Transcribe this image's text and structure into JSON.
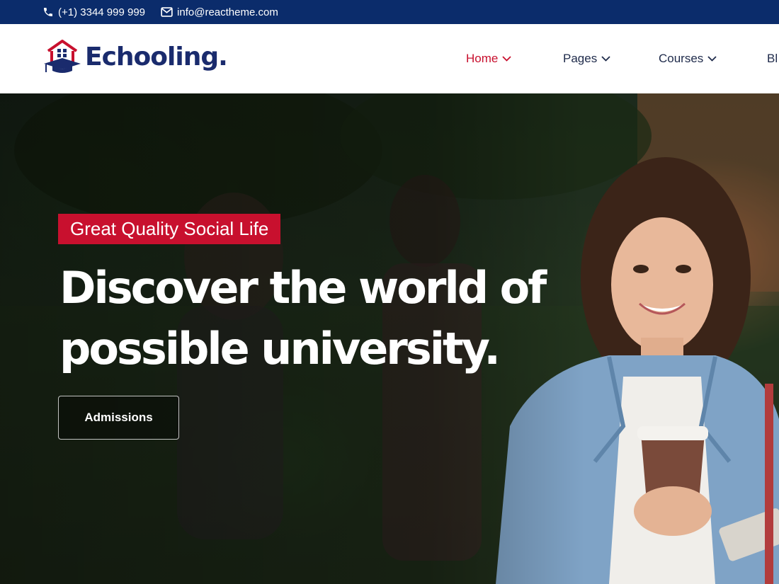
{
  "topbar": {
    "phone": "(+1) 3344 999 999",
    "email": "info@reactheme.com",
    "phone_icon": "phone-icon",
    "email_icon": "envelope-icon"
  },
  "header": {
    "logo_text": "Echooling.",
    "logo_icon": "house-graduation-cap-icon",
    "nav": [
      {
        "label": "Home",
        "active": true,
        "icon": "chevron-down-icon"
      },
      {
        "label": "Pages",
        "active": false,
        "icon": "chevron-down-icon"
      },
      {
        "label": "Courses",
        "active": false,
        "icon": "chevron-down-icon"
      },
      {
        "label": "Bl",
        "active": false
      }
    ]
  },
  "hero": {
    "tagline": "Great Quality Social Life",
    "headline_line1": "Discover the world of",
    "headline_line2": "possible university.",
    "cta_label": "Admissions"
  },
  "colors": {
    "topbar_bg": "#0b2c6b",
    "accent": "#c8102e",
    "brand_navy": "#1a2b6d",
    "nav_text": "#1e2a4a"
  }
}
